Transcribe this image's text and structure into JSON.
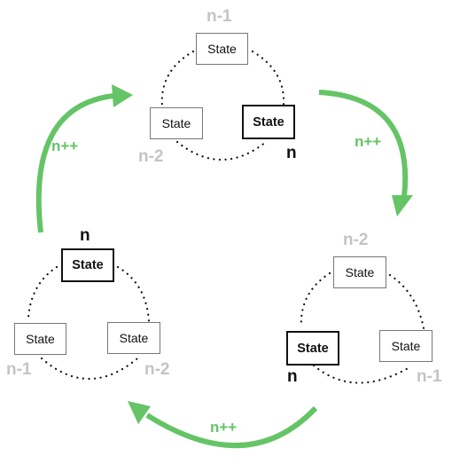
{
  "diagram": {
    "accent_color": "#64c466",
    "increment_label": "n++",
    "clusters": [
      {
        "name": "top",
        "states": [
          {
            "text": "State",
            "index_label": "n-1",
            "active": false
          },
          {
            "text": "State",
            "index_label": "n-2",
            "active": false
          },
          {
            "text": "State",
            "index_label": "n",
            "active": true
          }
        ]
      },
      {
        "name": "right",
        "states": [
          {
            "text": "State",
            "index_label": "n-2",
            "active": false
          },
          {
            "text": "State",
            "index_label": "n",
            "active": true
          },
          {
            "text": "State",
            "index_label": "n-1",
            "active": false
          }
        ]
      },
      {
        "name": "left",
        "states": [
          {
            "text": "State",
            "index_label": "n",
            "active": true
          },
          {
            "text": "State",
            "index_label": "n-1",
            "active": false
          },
          {
            "text": "State",
            "index_label": "n-2",
            "active": false
          }
        ]
      }
    ],
    "arrows": [
      {
        "label": "n++",
        "from": "left",
        "to": "top"
      },
      {
        "label": "n++",
        "from": "top",
        "to": "right"
      },
      {
        "label": "n++",
        "from": "right",
        "to": "left"
      }
    ]
  }
}
